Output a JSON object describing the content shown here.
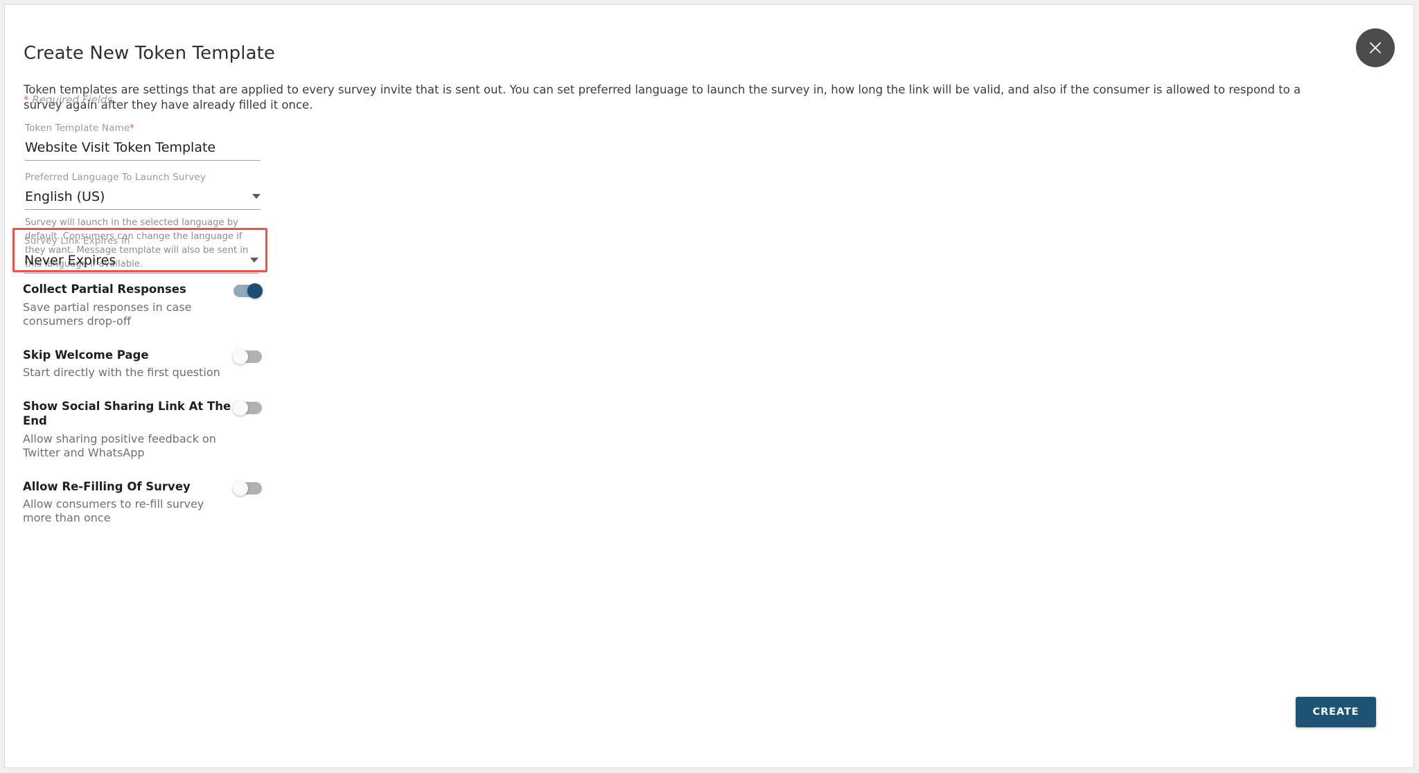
{
  "modal": {
    "title": "Create New Token Template",
    "description": "Token templates are settings that are applied to every survey invite that is sent out. You can set preferred language to launch the survey in, how long the link will be valid, and also if the consumer is allowed to respond to a survey again after they have already filled it once.",
    "required_note_star": "*",
    "required_note_text": " Required Fields",
    "close_icon": "close-icon"
  },
  "fields": {
    "name": {
      "label": "Token Template Name",
      "required_marker": "*",
      "value": "Website Visit Token Template",
      "placeholder": "Token Template Name"
    },
    "language": {
      "label": "Preferred Language To Launch Survey",
      "value": "English (US)",
      "help": "Survey will launch in the selected language by default. Consumers can change the language if they want. Message template will also be sent in this language if available.",
      "caret_icon": "chevron-down-icon"
    },
    "expiry": {
      "label": "Survey Link Expires In",
      "value": "Never Expires",
      "caret_icon": "chevron-down-icon",
      "highlighted": true,
      "highlight_color": "#e9534c"
    }
  },
  "toggles": [
    {
      "title": "Collect Partial Responses",
      "subtitle": "Save partial responses in case consumers drop-off",
      "state": "on"
    },
    {
      "title": "Skip Welcome Page",
      "subtitle": "Start directly with the first question",
      "state": "off"
    },
    {
      "title": "Show Social Sharing Link At The End",
      "subtitle": "Allow sharing positive feedback on Twitter and WhatsApp",
      "state": "off"
    },
    {
      "title": "Allow Re-Filling Of Survey",
      "subtitle": "Allow consumers to re-fill survey more than once",
      "state": "off"
    }
  ],
  "footer": {
    "create_label": "CREATE",
    "create_color": "#1e5375"
  }
}
